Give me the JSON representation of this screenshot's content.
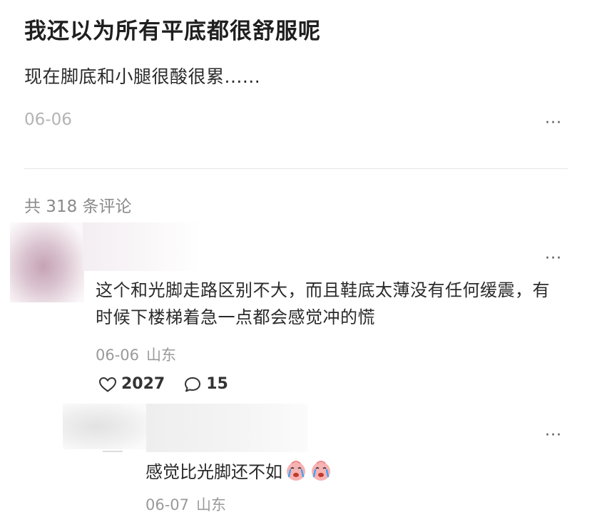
{
  "post": {
    "title": "我还以为所有平底都很舒服呢",
    "body": "现在脚底和小腿很酸很累......",
    "date": "06-06",
    "more": "···"
  },
  "comments_header": {
    "count_text": "共 318 条评论"
  },
  "comments": [
    {
      "text": "这个和光脚走路区别不大，而且鞋底太薄没有任何缓震，有时候下楼梯着急一点都会感觉冲的慌",
      "date": "06-06",
      "location": "山东",
      "likes": "2027",
      "replies": "15",
      "more": "···"
    },
    {
      "text": "感觉比光脚还不如",
      "date": "06-07",
      "location": "山东",
      "more": "···",
      "emoji_icons": [
        "crying-face-icon",
        "crying-face-icon"
      ]
    }
  ],
  "colors": {
    "divider": "#e6e6e6",
    "meta_gray": "#9a9a9a",
    "title": "#1f1f1f"
  }
}
